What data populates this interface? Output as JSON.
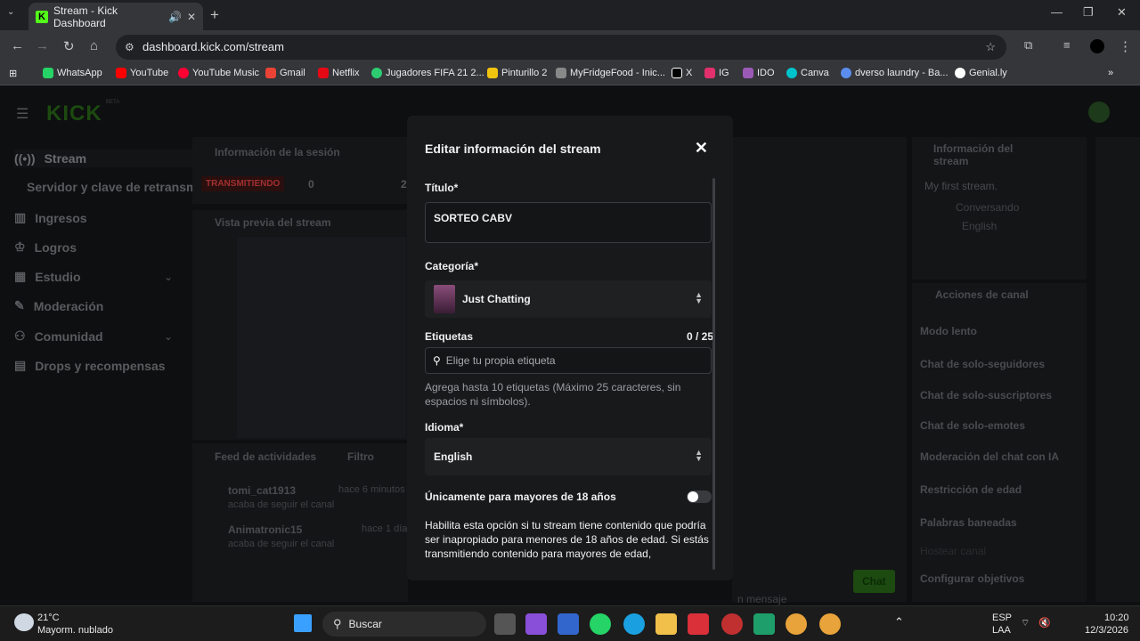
{
  "browser": {
    "tab_title": "Stream - Kick Dashboard",
    "tab_favicon": "K",
    "url": "dashboard.kick.com/stream",
    "bookmarks": [
      {
        "label": "WhatsApp",
        "color": "#25d366"
      },
      {
        "label": "YouTube",
        "color": "#ff0000"
      },
      {
        "label": "YouTube Music",
        "color": "#ff0033"
      },
      {
        "label": "Gmail",
        "color": "#ea4335"
      },
      {
        "label": "Netflix",
        "color": "#e50914"
      },
      {
        "label": "Jugadores FIFA 21 2...",
        "color": "#2ecc71"
      },
      {
        "label": "Pinturillo 2",
        "color": "#f1c40f"
      },
      {
        "label": "MyFridgeFood - Inic...",
        "color": "#888888"
      },
      {
        "label": "X",
        "color": "#ffffff"
      },
      {
        "label": "IG",
        "color": "#e1306c"
      },
      {
        "label": "IDO",
        "color": "#9b59b6"
      },
      {
        "label": "Canva",
        "color": "#00c4cc"
      },
      {
        "label": "dverso laundry - Ba...",
        "color": "#5b8def"
      },
      {
        "label": "Genial.ly",
        "color": "#ffffff"
      }
    ]
  },
  "sidebar": {
    "logo": "KICK",
    "logo_badge": "BETA",
    "items": [
      {
        "label": "Stream",
        "icon": "broadcast-icon"
      },
      {
        "label": "Servidor y clave de retransm",
        "icon": ""
      },
      {
        "label": "Ingresos",
        "icon": "bars-icon"
      },
      {
        "label": "Logros",
        "icon": "trophy-icon"
      },
      {
        "label": "Estudio",
        "icon": "studio-icon"
      },
      {
        "label": "Moderación",
        "icon": "wrench-icon"
      },
      {
        "label": "Comunidad",
        "icon": "people-icon"
      },
      {
        "label": "Drops y recompensas",
        "icon": "gift-icon"
      }
    ]
  },
  "background": {
    "session_title": "Información de la sesión",
    "live_badge": "TRANSMITIENDO",
    "session_value_a": "0",
    "session_value_b": "2",
    "preview_title": "Vista previa del stream",
    "feed_title": "Feed de actividades",
    "feed_filter": "Filtro",
    "feed": [
      {
        "user": "tomi_cat1913",
        "time": "hace 6 minutos",
        "action": "acaba de seguir el canal"
      },
      {
        "user": "Animatronic15",
        "time": "hace 1 día",
        "action": "acaba de seguir el canal"
      }
    ],
    "chat_placeholder": "n mensaje",
    "chat_button": "Chat",
    "info_title": "Información del stream",
    "stream_title": "My first stream.",
    "stream_category": "Conversando",
    "stream_language": "English",
    "channel_actions_title": "Acciones de canal",
    "channel_actions": [
      "Modo lento",
      "Chat de solo-seguidores",
      "Chat de solo-suscriptores",
      "Chat de solo-emotes",
      "Moderación del chat con IA",
      "Restricción de edad",
      "Palabras baneadas",
      "Hostear canal",
      "Configurar objetivos"
    ]
  },
  "modal": {
    "title": "Editar información del stream",
    "title_label": "Título*",
    "title_value": "SORTEO CABV",
    "category_label": "Categoría*",
    "category_value": "Just Chatting",
    "tags_label": "Etiquetas",
    "tags_counter": "0 / 25",
    "tags_placeholder": "Elige tu propia etiqueta",
    "tags_help": "Agrega hasta 10 etiquetas (Máximo 25 caracteres, sin espacios ni símbolos).",
    "language_label": "Idioma*",
    "language_value": "English",
    "adult_label": "Únicamente para mayores de 18 años",
    "adult_enabled": false,
    "adult_desc": "Habilita esta opción si tu stream tiene contenido que podría ser inapropiado para menores de 18 años de edad. Si estás transmitiendo contenido para mayores de edad,"
  },
  "taskbar": {
    "weather_temp": "21°C",
    "weather_desc": "Mayorm. nublado",
    "search_label": "Buscar",
    "lang": "ESP",
    "lang2": "LAA",
    "time": "10:20",
    "date": "12/3/2026"
  }
}
